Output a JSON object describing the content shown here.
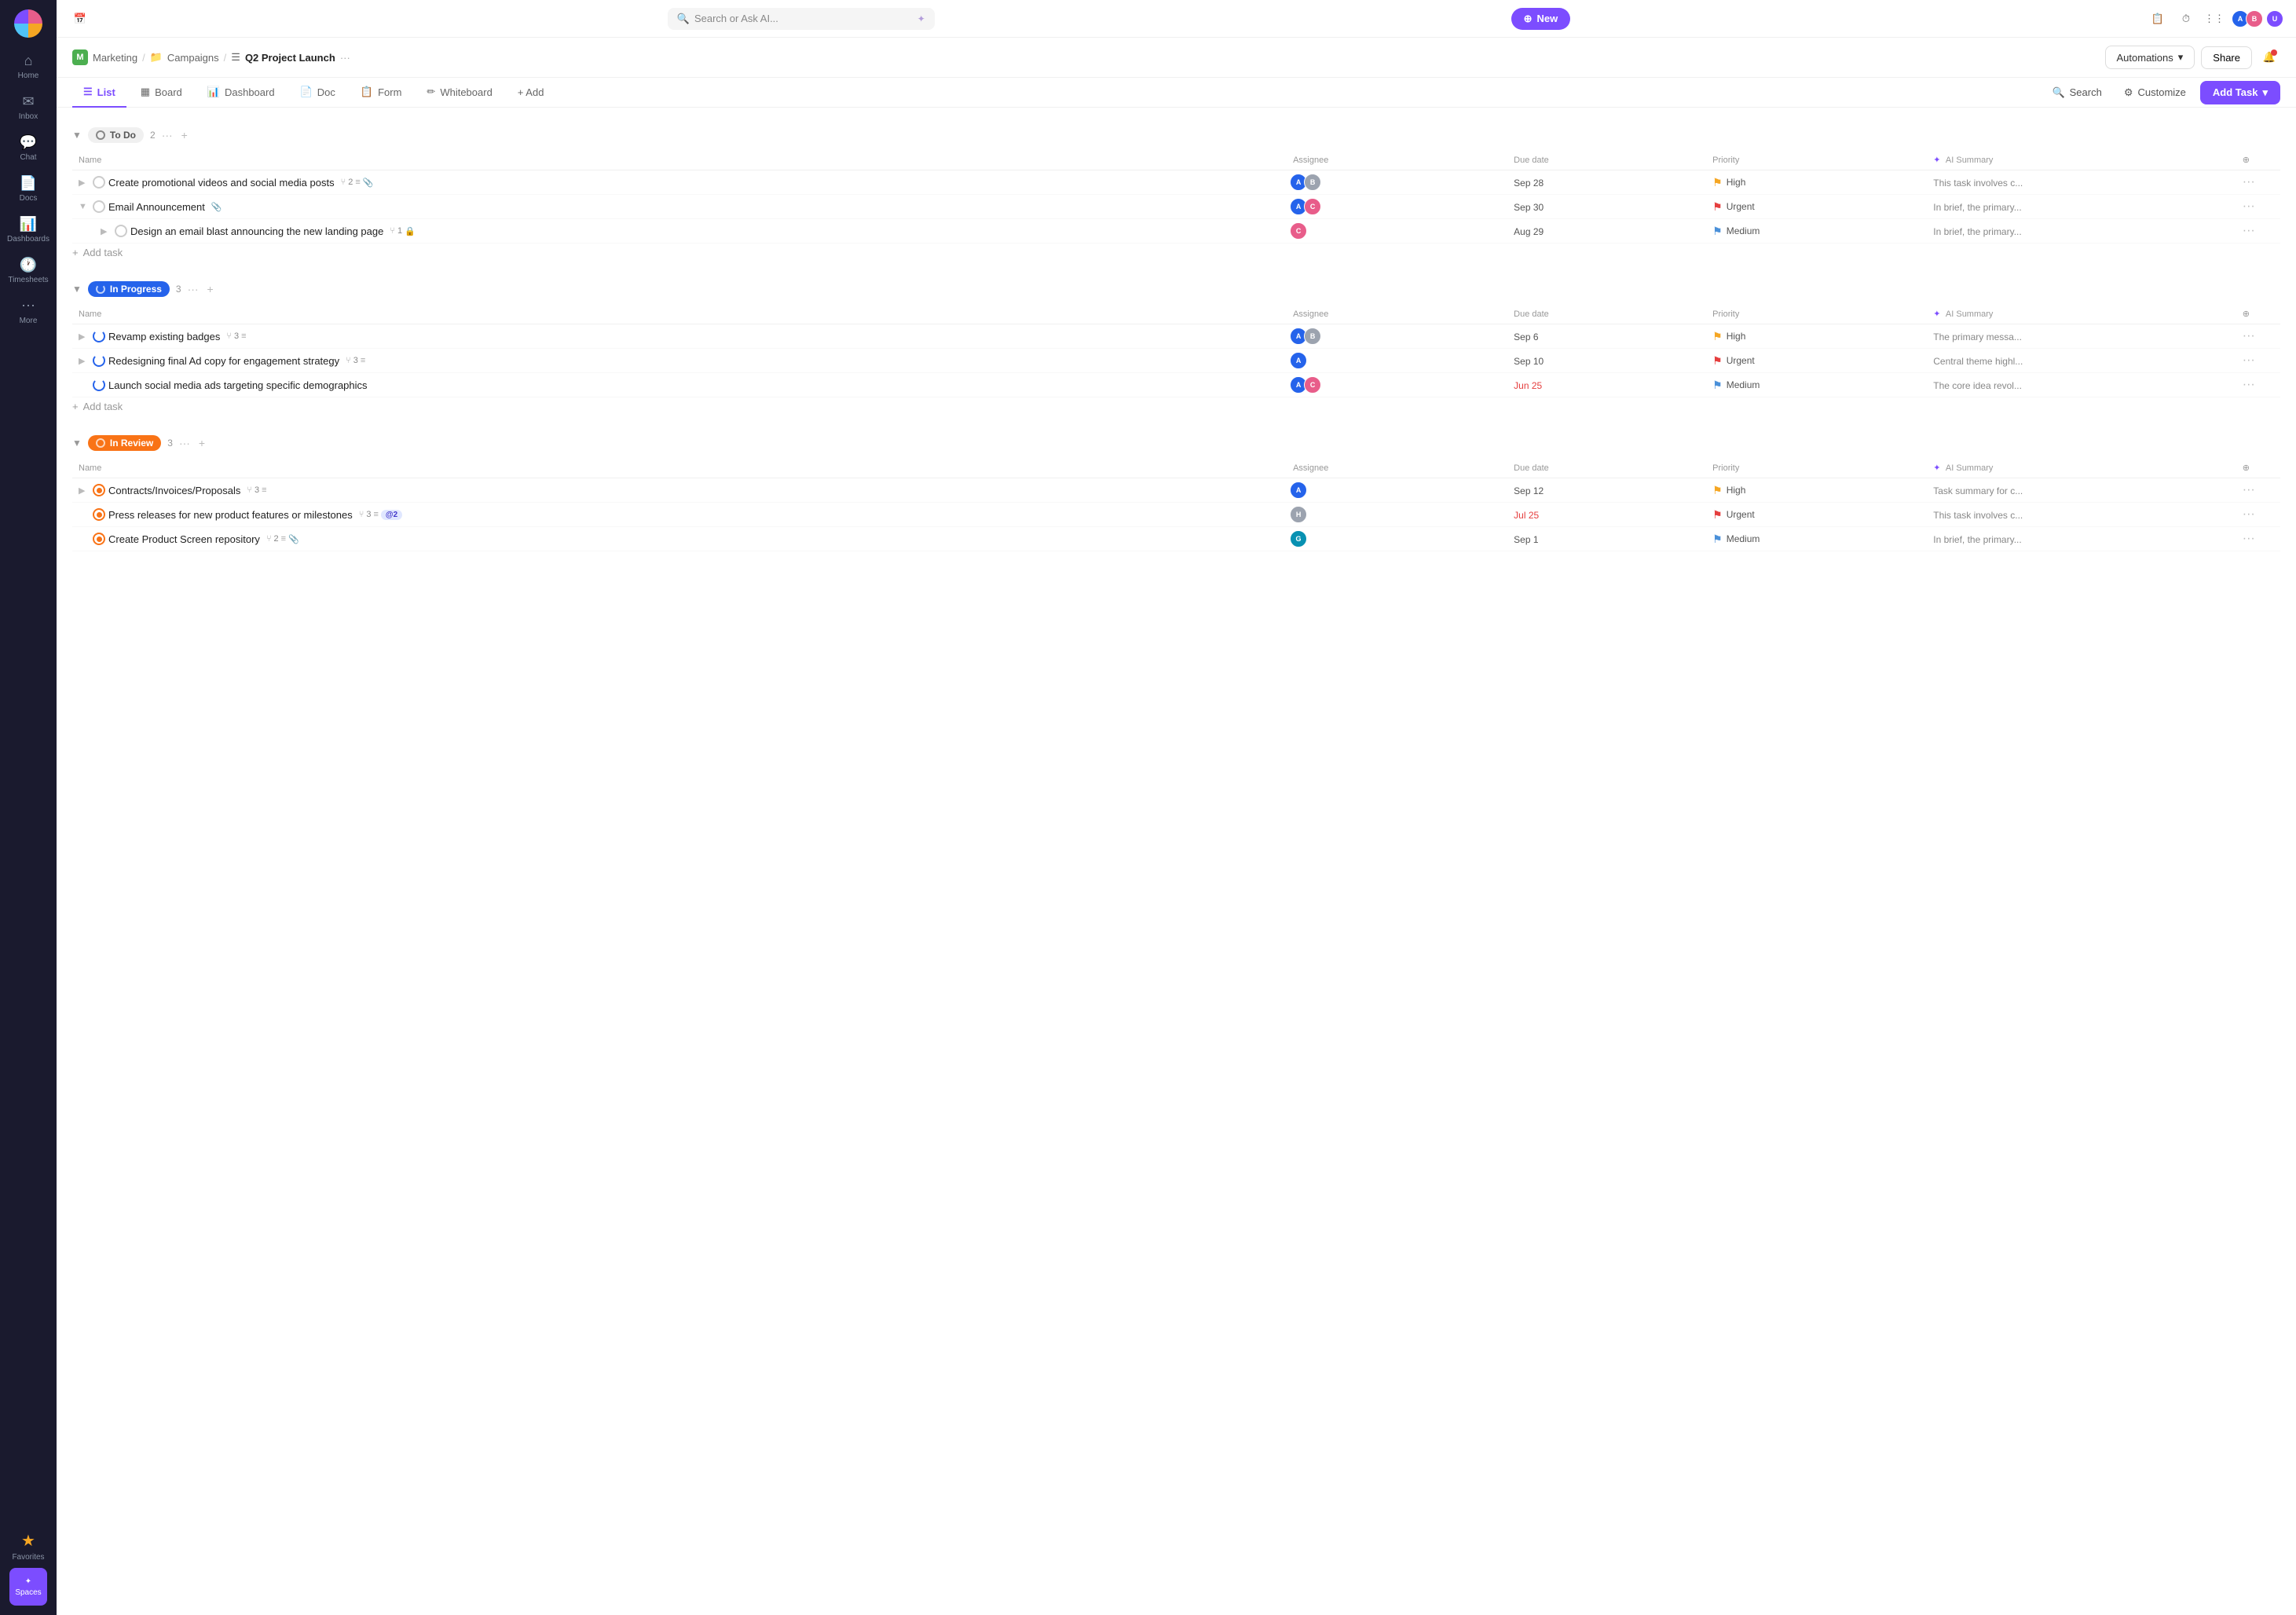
{
  "topbar": {
    "search_placeholder": "Search or Ask AI...",
    "new_label": "New"
  },
  "breadcrumb": {
    "workspace": "Marketing",
    "folder": "Campaigns",
    "page": "Q2 Project Launch",
    "automations_label": "Automations",
    "share_label": "Share"
  },
  "tabs": [
    {
      "id": "list",
      "label": "List",
      "active": true
    },
    {
      "id": "board",
      "label": "Board",
      "active": false
    },
    {
      "id": "dashboard",
      "label": "Dashboard",
      "active": false
    },
    {
      "id": "doc",
      "label": "Doc",
      "active": false
    },
    {
      "id": "form",
      "label": "Form",
      "active": false
    },
    {
      "id": "whiteboard",
      "label": "Whiteboard",
      "active": false
    },
    {
      "id": "add",
      "label": "+ Add",
      "active": false
    }
  ],
  "toolbar": {
    "search_label": "Search",
    "customize_label": "Customize",
    "add_task_label": "Add Task"
  },
  "columns": {
    "name": "Name",
    "assignee": "Assignee",
    "due_date": "Due date",
    "priority": "Priority",
    "ai_summary": "AI Summary"
  },
  "groups": [
    {
      "id": "todo",
      "status": "To Do",
      "badge_type": "todo",
      "count": 2,
      "tasks": [
        {
          "name": "Create promotional videos and social media posts",
          "subtask_count": 2,
          "has_list": true,
          "has_attach": true,
          "due_date": "Sep 28",
          "due_overdue": false,
          "priority": "High",
          "priority_type": "high",
          "ai_summary": "This task involves c...",
          "assignees": [
            "blue",
            "gray"
          ],
          "indent": 0,
          "expandable": true
        },
        {
          "name": "Email Announcement",
          "subtask_count": 0,
          "has_list": false,
          "has_attach": false,
          "has_attach2": true,
          "due_date": "Sep 30",
          "due_overdue": false,
          "priority": "Urgent",
          "priority_type": "urgent",
          "ai_summary": "In brief, the primary...",
          "assignees": [
            "blue",
            "pink"
          ],
          "indent": 0,
          "expandable": true,
          "expanded": true
        },
        {
          "name": "Design an email blast announcing the new landing page",
          "subtask_count": 1,
          "has_list": false,
          "has_attach": false,
          "has_lock": true,
          "due_date": "Aug 29",
          "due_overdue": false,
          "priority": "Medium",
          "priority_type": "medium",
          "ai_summary": "In brief, the primary...",
          "assignees": [
            "pink2"
          ],
          "indent": 1,
          "expandable": true
        }
      ]
    },
    {
      "id": "inprogress",
      "status": "In Progress",
      "badge_type": "inprogress",
      "count": 3,
      "tasks": [
        {
          "name": "Revamp existing badges",
          "subtask_count": 3,
          "has_list": true,
          "due_date": "Sep 6",
          "due_overdue": false,
          "priority": "High",
          "priority_type": "high",
          "ai_summary": "The primary messa...",
          "assignees": [
            "blue",
            "gray"
          ],
          "indent": 0,
          "expandable": true
        },
        {
          "name": "Redesigning final Ad copy for engagement strategy",
          "subtask_count": 3,
          "has_list": true,
          "due_date": "Sep 10",
          "due_overdue": false,
          "priority": "Urgent",
          "priority_type": "urgent",
          "ai_summary": "Central theme highl...",
          "assignees": [
            "blue"
          ],
          "indent": 0,
          "expandable": true
        },
        {
          "name": "Launch social media ads targeting specific demographics",
          "subtask_count": 0,
          "has_list": false,
          "due_date": "Jun 25",
          "due_overdue": true,
          "priority": "Medium",
          "priority_type": "medium",
          "ai_summary": "The core idea revol...",
          "assignees": [
            "blue",
            "pink"
          ],
          "indent": 0,
          "expandable": false
        }
      ]
    },
    {
      "id": "inreview",
      "status": "In Review",
      "badge_type": "inreview",
      "count": 3,
      "tasks": [
        {
          "name": "Contracts/Invoices/Proposals",
          "subtask_count": 3,
          "has_list": true,
          "due_date": "Sep 12",
          "due_overdue": false,
          "priority": "High",
          "priority_type": "high",
          "ai_summary": "Task summary for c...",
          "assignees": [
            "blue"
          ],
          "indent": 0,
          "expandable": true
        },
        {
          "name": "Press releases for new product features or milestones",
          "subtask_count": 3,
          "has_list": true,
          "has_badge2": true,
          "badge2_count": 2,
          "due_date": "Jul 25",
          "due_overdue": true,
          "priority": "Urgent",
          "priority_type": "urgent",
          "ai_summary": "This task involves c...",
          "assignees": [
            "gray2"
          ],
          "indent": 0,
          "expandable": false
        },
        {
          "name": "Create Product Screen repository",
          "subtask_count": 2,
          "has_list": true,
          "has_attach": true,
          "due_date": "Sep 1",
          "due_overdue": false,
          "priority": "Medium",
          "priority_type": "medium",
          "ai_summary": "In brief, the primary...",
          "assignees": [
            "teal"
          ],
          "indent": 0,
          "expandable": false
        }
      ]
    }
  ]
}
